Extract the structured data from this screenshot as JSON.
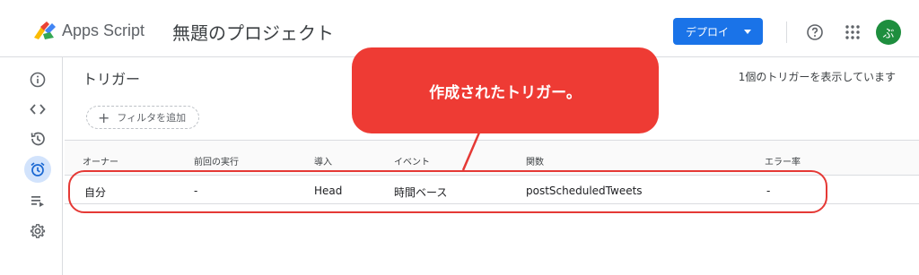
{
  "header": {
    "app_name": "Apps Script",
    "project_title": "無題のプロジェクト",
    "deploy_label": "デプロイ",
    "avatar_initial": "ぶ"
  },
  "colors": {
    "accent": "#1a73e8",
    "avatar_bg": "#1e8e3e",
    "annotation": "#ee3b34"
  },
  "sidebar": {
    "items": [
      {
        "icon": "info-icon"
      },
      {
        "icon": "code-icon"
      },
      {
        "icon": "history-icon"
      },
      {
        "icon": "alarm-clock-icon",
        "active": true
      },
      {
        "icon": "executions-icon"
      },
      {
        "icon": "gear-icon"
      }
    ]
  },
  "main": {
    "title": "トリガー",
    "trigger_count": "1個のトリガーを表示しています",
    "filter_label": "フィルタを追加",
    "columns": [
      "オーナー",
      "前回の実行",
      "導入",
      "イベント",
      "関数",
      "エラー率"
    ],
    "rows": [
      [
        "自分",
        "-",
        "Head",
        "時間ベース",
        "postScheduledTweets",
        "-"
      ]
    ]
  },
  "annotation": {
    "text": "作成されたトリガー。"
  }
}
